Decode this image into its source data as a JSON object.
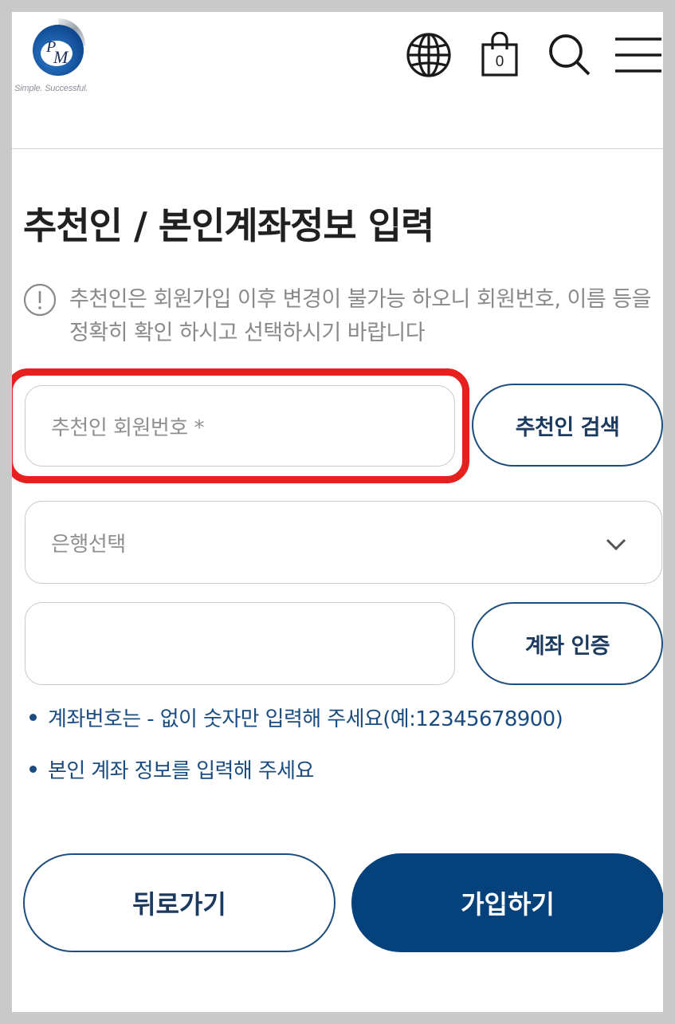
{
  "header": {
    "tagline": "Simple. Successful.",
    "logo_text": "PM",
    "cart_count": "0",
    "icons": [
      "globe-icon",
      "shopping-bag-icon",
      "search-icon",
      "hamburger-menu-icon"
    ]
  },
  "page": {
    "title": "추천인 / 본인계좌정보 입력",
    "notice": "추천인은 회원가입 이후 변경이 불가능 하오니 회원번호, 이름 등을 정확히 확인 하시고 선택하시기 바랍니다"
  },
  "form": {
    "referrer_placeholder": "추천인 회원번호 *",
    "referrer_search_button": "추천인 검색",
    "bank_select_placeholder": "은행선택",
    "account_value": "",
    "account_verify_button": "계좌 인증"
  },
  "hints": [
    "계좌번호는 - 없이 숫자만 입력해 주세요(예:12345678900)",
    "본인 계좌 정보를 입력해 주세요"
  ],
  "actions": {
    "back_label": "뒤로가기",
    "join_label": "가입하기"
  },
  "colors": {
    "primary": "#05427c",
    "accent_text": "#1b4c80",
    "highlight": "#e5201f"
  }
}
